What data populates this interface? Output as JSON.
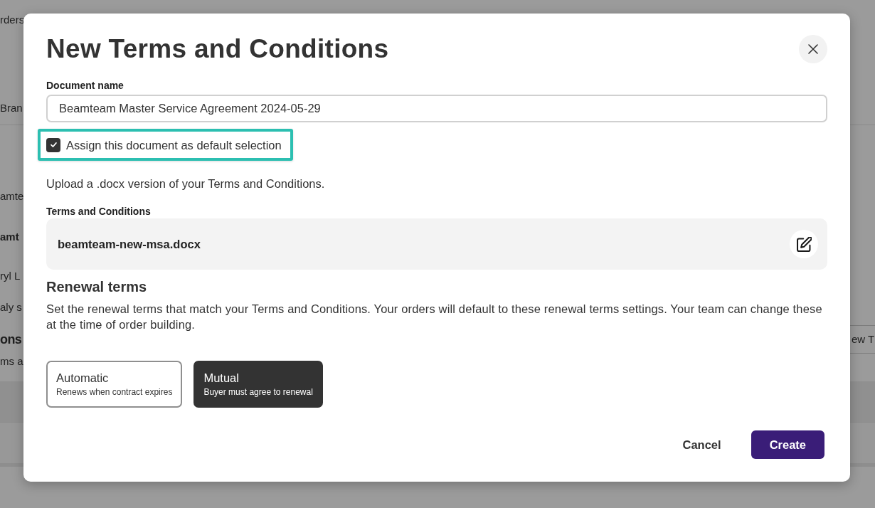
{
  "background": {
    "nav_tab": "rders",
    "tab": "Bran",
    "items": [
      {
        "text": "amte",
        "kind": "plain"
      },
      {
        "text": "amt",
        "kind": "bold"
      },
      {
        "text": "ryl L",
        "kind": "plain"
      },
      {
        "text": "aly s",
        "kind": "plain"
      }
    ],
    "section_title": "ons",
    "section_button": "ew T",
    "section_text": "ms a"
  },
  "dialog": {
    "title": "New Terms and Conditions",
    "document_name": {
      "label": "Document name",
      "value": "Beamteam Master Service Agreement 2024-05-29"
    },
    "default_checkbox": {
      "label": "Assign this document as default selection",
      "checked": true,
      "highlighted": true
    },
    "upload_hint": "Upload a .docx version of your Terms and Conditions.",
    "file": {
      "label": "Terms and Conditions",
      "filename": "beamteam-new-msa.docx"
    },
    "renewal": {
      "title": "Renewal terms",
      "description": "Set the renewal terms that match your Terms and Conditions. Your orders will default to these renewal terms settings. Your team can change these at the time of order building.",
      "options": [
        {
          "title": "Automatic",
          "subtitle": "Renews when contract expires",
          "selected": false
        },
        {
          "title": "Mutual",
          "subtitle": "Buyer must agree to renewal",
          "selected": true
        }
      ]
    },
    "buttons": [
      {
        "label": "Cancel",
        "kind": "secondary"
      },
      {
        "label": "Create",
        "kind": "primary"
      }
    ]
  }
}
